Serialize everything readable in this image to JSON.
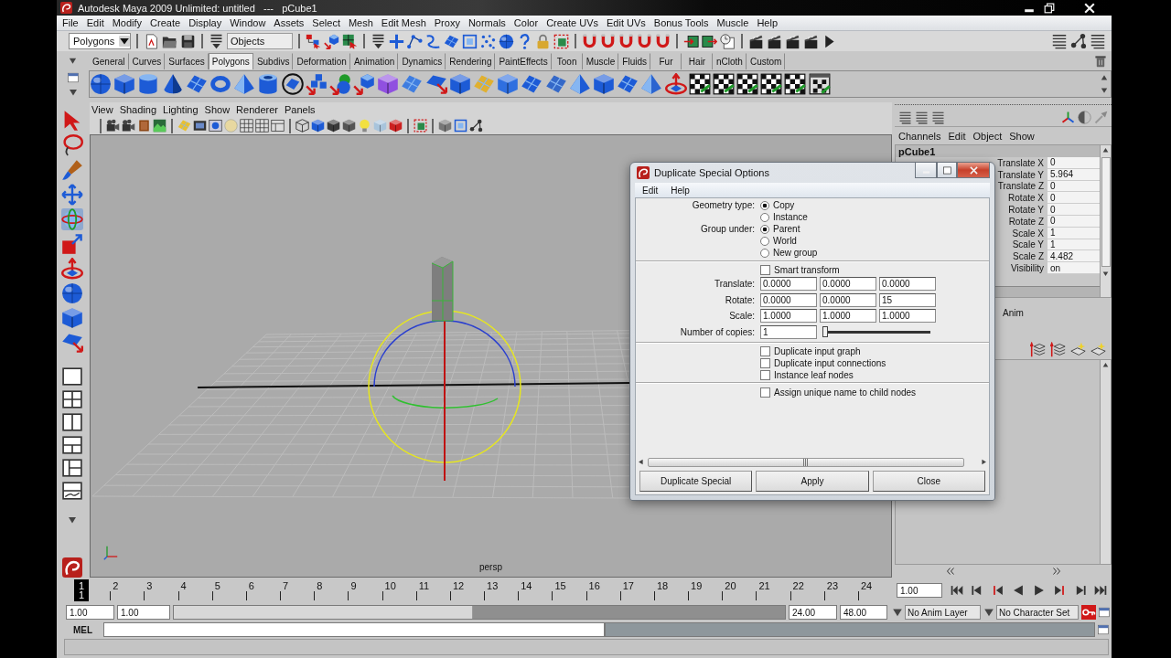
{
  "window": {
    "title": "Autodesk Maya 2009 Unlimited: untitled   ---   pCube1"
  },
  "menu_bar": [
    "File",
    "Edit",
    "Modify",
    "Create",
    "Display",
    "Window",
    "Assets",
    "Select",
    "Mesh",
    "Edit Mesh",
    "Proxy",
    "Normals",
    "Color",
    "Create UVs",
    "Edit UVs",
    "Bonus Tools",
    "Muscle",
    "Help"
  ],
  "status_line": {
    "menu_set": "Polygons",
    "selection_mask": "Objects"
  },
  "shelf": {
    "tabs": [
      {
        "label": "General",
        "selected": false
      },
      {
        "label": "Curves",
        "selected": false
      },
      {
        "label": "Surfaces",
        "selected": false
      },
      {
        "label": "Polygons",
        "selected": true
      },
      {
        "label": "Subdivs",
        "selected": false
      },
      {
        "label": "Deformation",
        "selected": false
      },
      {
        "label": "Animation",
        "selected": false
      },
      {
        "label": "Dynamics",
        "selected": false
      },
      {
        "label": "Rendering",
        "selected": false
      },
      {
        "label": "PaintEffects",
        "selected": false
      },
      {
        "label": "Toon",
        "selected": false
      },
      {
        "label": "Muscle",
        "selected": false
      },
      {
        "label": "Fluids",
        "selected": false
      },
      {
        "label": "Fur",
        "selected": false
      },
      {
        "label": "Hair",
        "selected": false
      },
      {
        "label": "nCloth",
        "selected": false
      },
      {
        "label": "Custom",
        "selected": false
      }
    ]
  },
  "toolbox": {
    "tools": [
      {
        "selected": false
      },
      {
        "selected": false
      },
      {
        "selected": false
      },
      {
        "selected": false
      },
      {
        "selected": true
      },
      {
        "selected": false
      },
      {
        "selected": false
      },
      {
        "selected": false
      },
      {
        "selected": false
      },
      {
        "selected": false
      }
    ]
  },
  "viewport": {
    "menu": [
      "View",
      "Shading",
      "Lighting",
      "Show",
      "Renderer",
      "Panels"
    ],
    "camera": "persp"
  },
  "channel_box": {
    "menu": [
      "Channels",
      "Edit",
      "Object",
      "Show"
    ],
    "object": "pCube1",
    "attributes": [
      {
        "name": "Translate X",
        "value": "0"
      },
      {
        "name": "Translate Y",
        "value": "5.964"
      },
      {
        "name": "Translate Z",
        "value": "0"
      },
      {
        "name": "Rotate X",
        "value": "0"
      },
      {
        "name": "Rotate Y",
        "value": "0"
      },
      {
        "name": "Rotate Z",
        "value": "0"
      },
      {
        "name": "Scale X",
        "value": "1"
      },
      {
        "name": "Scale Y",
        "value": "1"
      },
      {
        "name": "Scale Z",
        "value": "4.482"
      },
      {
        "name": "Visibility",
        "value": "on"
      }
    ],
    "layer_tab": "Anim"
  },
  "dialog": {
    "title": "Duplicate Special Options",
    "menu": [
      "Edit",
      "Help"
    ],
    "radio_groups": [
      {
        "label": "Geometry type:",
        "options": [
          {
            "label": "Copy",
            "selected": true
          },
          {
            "label": "Instance",
            "selected": false
          }
        ]
      },
      {
        "label": "Group under:",
        "options": [
          {
            "label": "Parent",
            "selected": true
          },
          {
            "label": "World",
            "selected": false
          },
          {
            "label": "New group",
            "selected": false
          }
        ]
      }
    ],
    "smart_transform": {
      "label": "Smart transform",
      "checked": false
    },
    "vectors": [
      {
        "label": "Translate:",
        "values": [
          "0.0000",
          "0.0000",
          "0.0000"
        ]
      },
      {
        "label": "Rotate:",
        "values": [
          "0.0000",
          "0.0000",
          "15"
        ]
      },
      {
        "label": "Scale:",
        "values": [
          "1.0000",
          "1.0000",
          "1.0000"
        ]
      }
    ],
    "copies": {
      "label": "Number of copies:",
      "value": "1",
      "level": 0
    },
    "input_options": [
      {
        "label": "Duplicate input graph",
        "checked": false
      },
      {
        "label": "Duplicate input connections",
        "checked": false
      },
      {
        "label": "Instance leaf nodes",
        "checked": false
      }
    ],
    "naming_options": [
      {
        "label": "Assign unique name to child nodes",
        "checked": false
      }
    ],
    "buttons": [
      "Duplicate Special",
      "Apply",
      "Close"
    ]
  },
  "time_slider": {
    "frames": [
      {
        "label": "1",
        "selected": true
      },
      {
        "label": "2",
        "selected": false
      },
      {
        "label": "3",
        "selected": false
      },
      {
        "label": "4",
        "selected": false
      },
      {
        "label": "5",
        "selected": false
      },
      {
        "label": "6",
        "selected": false
      },
      {
        "label": "7",
        "selected": false
      },
      {
        "label": "8",
        "selected": false
      },
      {
        "label": "9",
        "selected": false
      },
      {
        "label": "10",
        "selected": false
      },
      {
        "label": "11",
        "selected": false
      },
      {
        "label": "12",
        "selected": false
      },
      {
        "label": "13",
        "selected": false
      },
      {
        "label": "14",
        "selected": false
      },
      {
        "label": "15",
        "selected": false
      },
      {
        "label": "16",
        "selected": false
      },
      {
        "label": "17",
        "selected": false
      },
      {
        "label": "18",
        "selected": false
      },
      {
        "label": "19",
        "selected": false
      },
      {
        "label": "20",
        "selected": false
      },
      {
        "label": "21",
        "selected": false
      },
      {
        "label": "22",
        "selected": false
      },
      {
        "label": "23",
        "selected": false
      },
      {
        "label": "24",
        "selected": false
      }
    ],
    "current_frame": "1",
    "current_time": "1.00"
  },
  "range_slider": {
    "start": "1.00",
    "range_start": "1.00",
    "range_end": "24.00",
    "end": "48.00",
    "level": 0.49
  },
  "anim_layer": "No Anim Layer",
  "character_set": "No Character Set",
  "command_line": {
    "language": "MEL"
  }
}
